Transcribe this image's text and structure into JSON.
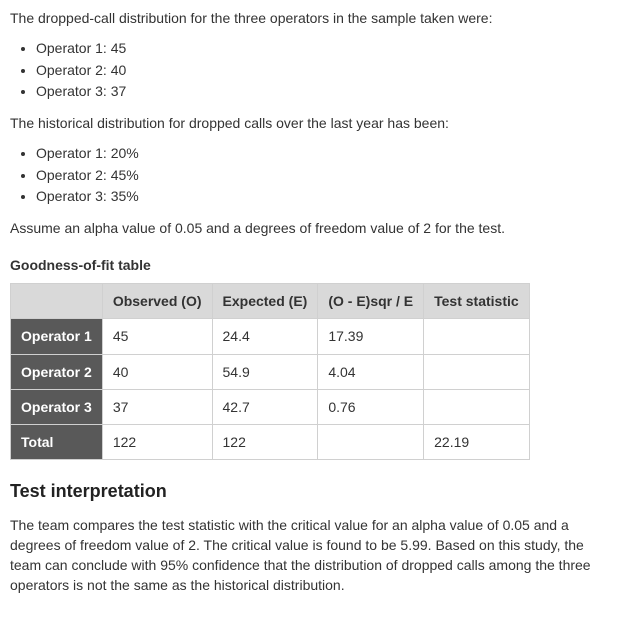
{
  "intro_line": "The dropped-call distribution for the three operators in the sample taken were:",
  "sample_list": [
    "Operator 1: 45",
    "Operator 2: 40",
    "Operator 3: 37"
  ],
  "historical_line": "The historical distribution for dropped calls over the last year has been:",
  "historical_list": [
    "Operator 1: 20%",
    "Operator 2: 45%",
    "Operator 3: 35%"
  ],
  "assumption_line": "Assume an alpha value of 0.05 and a degrees of freedom value of 2 for the test.",
  "table": {
    "title": "Goodness-of-fit table",
    "headers": {
      "observed": "Observed (O)",
      "expected": "Expected (E)",
      "oesqr": "(O - E)sqr / E",
      "teststat": "Test statistic"
    },
    "rows": [
      {
        "label": "Operator 1",
        "observed": "45",
        "expected": "24.4",
        "oesqr": "17.39",
        "teststat": ""
      },
      {
        "label": "Operator 2",
        "observed": "40",
        "expected": "54.9",
        "oesqr": "4.04",
        "teststat": ""
      },
      {
        "label": "Operator 3",
        "observed": "37",
        "expected": "42.7",
        "oesqr": "0.76",
        "teststat": ""
      },
      {
        "label": "Total",
        "observed": "122",
        "expected": "122",
        "oesqr": "",
        "teststat": "22.19"
      }
    ]
  },
  "interpretation": {
    "heading": "Test interpretation",
    "body": "The team compares the test statistic with the critical value for an alpha value of 0.05 and a degrees of freedom value of 2. The critical value is found to be 5.99. Based on this study, the team can conclude with 95% confidence that the distribution of dropped calls among the three operators is not the same as the historical distribution."
  },
  "chart_data": {
    "type": "table",
    "title": "Goodness-of-fit table",
    "columns": [
      "Operator",
      "Observed (O)",
      "Expected (E)",
      "(O - E)sqr / E",
      "Test statistic"
    ],
    "rows": [
      [
        "Operator 1",
        45,
        24.4,
        17.39,
        null
      ],
      [
        "Operator 2",
        40,
        54.9,
        4.04,
        null
      ],
      [
        "Operator 3",
        37,
        42.7,
        0.76,
        null
      ],
      [
        "Total",
        122,
        122,
        null,
        22.19
      ]
    ],
    "alpha": 0.05,
    "degrees_of_freedom": 2,
    "critical_value": 5.99,
    "historical_percent": {
      "Operator 1": 20,
      "Operator 2": 45,
      "Operator 3": 35
    }
  }
}
